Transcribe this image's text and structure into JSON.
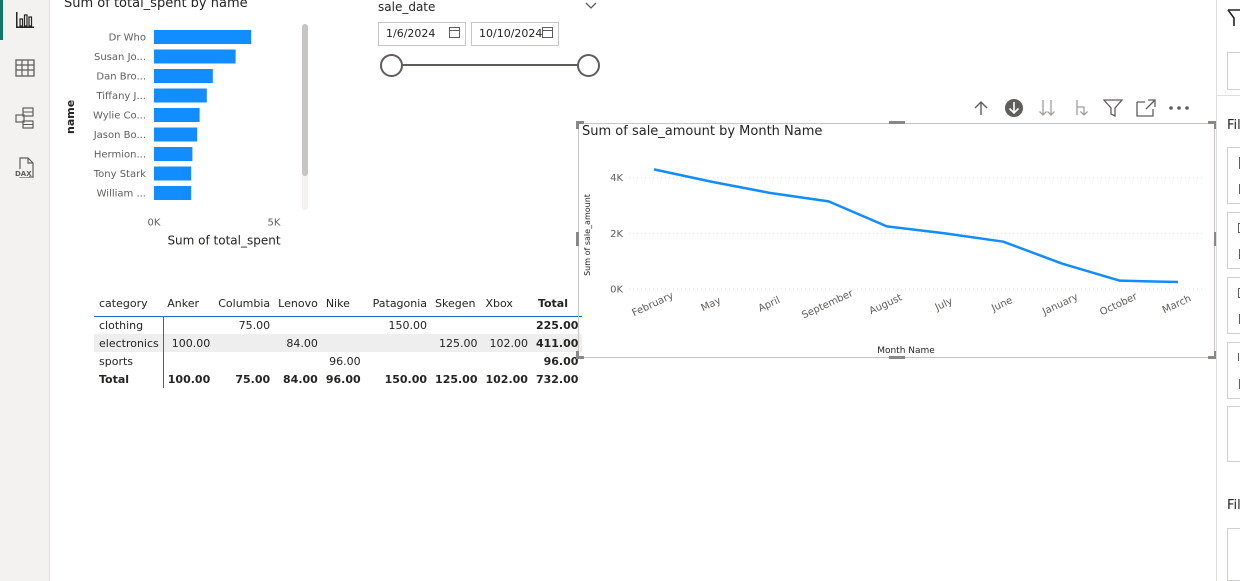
{
  "rail": {
    "items": [
      {
        "name": "report-view-button",
        "icon": "bar-chart-icon",
        "active": true
      },
      {
        "name": "table-view-button",
        "icon": "table-grid-icon",
        "active": false
      },
      {
        "name": "model-view-button",
        "icon": "model-icon",
        "active": false
      },
      {
        "name": "dax-query-view-button",
        "icon": "dax-icon",
        "active": false,
        "label": "DAX"
      }
    ]
  },
  "bar_chart": {
    "title": "Sum of total_spent by name",
    "ylabel": "name",
    "xlabel": "Sum of total_spent",
    "bar_color": "#118dff"
  },
  "slicer": {
    "title": "sale_date",
    "start_date": "1/6/2024",
    "end_date": "10/10/2024"
  },
  "matrix": {
    "headers": [
      "category",
      "Anker",
      "Columbia",
      "Lenovo",
      "Nike",
      "Patagonia",
      "Skegen",
      "Xbox",
      "Total"
    ],
    "rows": [
      {
        "label": "clothing",
        "cells": [
          "",
          "75.00",
          "",
          "",
          "150.00",
          "",
          "",
          "225.00"
        ]
      },
      {
        "label": "electronics",
        "cells": [
          "100.00",
          "",
          "84.00",
          "",
          "",
          "125.00",
          "102.00",
          "411.00"
        ]
      },
      {
        "label": "sports",
        "cells": [
          "",
          "",
          "",
          "96.00",
          "",
          "",
          "",
          "96.00"
        ]
      }
    ],
    "total_row": {
      "label": "Total",
      "cells": [
        "100.00",
        "75.00",
        "84.00",
        "96.00",
        "150.00",
        "125.00",
        "102.00",
        "732.00"
      ]
    }
  },
  "line_visual": {
    "title": "Sum of sale_amount by Month Name",
    "toolbar": [
      "drill-up-icon",
      "drill-down-on-icon",
      "expand-all-icon",
      "expand-next-level-icon",
      "filter-icon",
      "focus-mode-icon",
      "more-options-icon"
    ]
  },
  "right_pane": {
    "label_top": "Fil",
    "label_bottom": "Fil",
    "accent": "#252423"
  },
  "chart_data": [
    {
      "type": "bar",
      "orientation": "horizontal",
      "title": "Sum of total_spent by name",
      "xlabel": "Sum of total_spent",
      "ylabel": "name",
      "categories": [
        "Dr Who",
        "Susan Jo...",
        "Dan Bro...",
        "Tiffany J...",
        "Wylie Co...",
        "Jason Bo...",
        "Hermion...",
        "Tony Stark",
        "William ..."
      ],
      "values": [
        4050,
        3400,
        2450,
        2200,
        1900,
        1800,
        1600,
        1550,
        1550
      ],
      "xticks": [
        "0K",
        "5K"
      ],
      "xlim": [
        0,
        5000
      ],
      "color": "#118dff"
    },
    {
      "type": "line",
      "title": "Sum of sale_amount by Month Name",
      "xlabel": "Month Name",
      "ylabel": "Sum of sale_amount",
      "x": [
        "February",
        "May",
        "April",
        "September",
        "August",
        "July",
        "June",
        "January",
        "October",
        "March"
      ],
      "values": [
        4300,
        3850,
        3450,
        3150,
        2250,
        2000,
        1700,
        920,
        300,
        250
      ],
      "yticks": [
        "0K",
        "2K",
        "4K"
      ],
      "ylim": [
        0,
        4600
      ],
      "grid": true,
      "color": "#118dff"
    }
  ]
}
